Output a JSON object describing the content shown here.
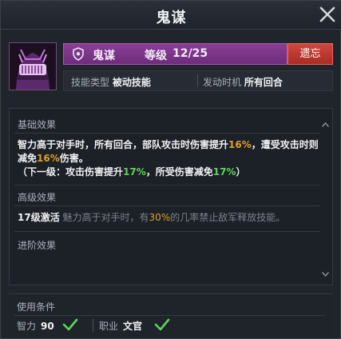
{
  "window": {
    "title": "鬼谋"
  },
  "skill": {
    "name": "鬼谋",
    "level_label": "等级",
    "level_value": "12/25",
    "forget_button": "遗忘",
    "type_label": "技能类型",
    "type_value": "被动技能",
    "trigger_label": "发动时机",
    "trigger_value": "所有回合"
  },
  "effects": {
    "basic_title": "基础效果",
    "basic_line1_a": "智力高于对手时，所有回合，部队攻击时伤害提升",
    "basic_line1_pct": "16%",
    "basic_line1_b": "，遭受攻击时则",
    "basic_line2_a": "减免",
    "basic_line2_pct": "16%",
    "basic_line2_b": "伤害。",
    "next_level_a": "（下一级：攻击伤害提升",
    "next_level_pct1": "17%",
    "next_level_b": "，所受伤害减免",
    "next_level_pct2": "17%",
    "next_level_c": "）",
    "advanced_title": "高级效果",
    "advanced_activate": "17级激活",
    "advanced_text_a": "魅力高于对手时，有",
    "advanced_pct": "30%",
    "advanced_text_b": "的几率禁止敌军释放技能。",
    "evolve_title": "进阶效果"
  },
  "conditions": {
    "title": "使用条件",
    "intellect_label": "智力",
    "intellect_value": "90",
    "profession_label": "职业",
    "profession_value": "文官"
  },
  "colors": {
    "header_purple": "#7a3488",
    "forget_red": "#bf3a30",
    "highlight_orange": "#e0a02b",
    "highlight_green": "#5fd35a"
  }
}
